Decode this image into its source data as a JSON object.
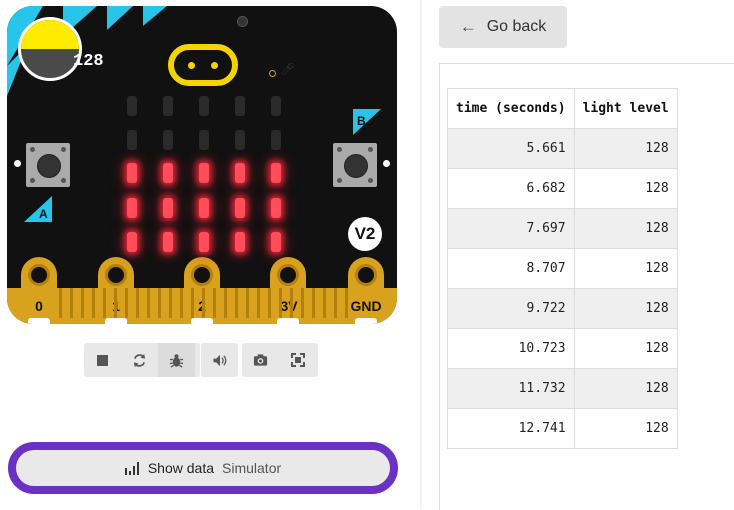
{
  "simulator": {
    "light_level": "128",
    "version_badge": "V2",
    "button_a": "A",
    "button_b": "B",
    "led_rows": [
      [
        0,
        0,
        0,
        0,
        0
      ],
      [
        0,
        0,
        0,
        0,
        0
      ],
      [
        1,
        1,
        1,
        1,
        1
      ],
      [
        1,
        1,
        1,
        1,
        1
      ],
      [
        1,
        1,
        1,
        1,
        1
      ]
    ],
    "pins": [
      "0",
      "1",
      "2",
      "3V",
      "GND"
    ],
    "colors": {
      "board": "#111111",
      "edge_gold": "#d8a21e",
      "led_on": "#ff4d5a",
      "accent_cyan": "#27c5ea",
      "light_yellow": "#ffeb00",
      "highlight_purple": "#6b30c4"
    }
  },
  "toolbar": {
    "icons": [
      "stop-icon",
      "restart-icon",
      "debug-icon",
      "sound-icon",
      "screenshot-icon",
      "fullscreen-icon"
    ]
  },
  "show_data": {
    "label": "Show data",
    "sublabel": "Simulator"
  },
  "right": {
    "go_back": "Go back",
    "table": {
      "headers": [
        "time (seconds)",
        "light level"
      ],
      "rows": [
        [
          "5.661",
          "128"
        ],
        [
          "6.682",
          "128"
        ],
        [
          "7.697",
          "128"
        ],
        [
          "8.707",
          "128"
        ],
        [
          "9.722",
          "128"
        ],
        [
          "10.723",
          "128"
        ],
        [
          "11.732",
          "128"
        ],
        [
          "12.741",
          "128"
        ]
      ]
    }
  }
}
